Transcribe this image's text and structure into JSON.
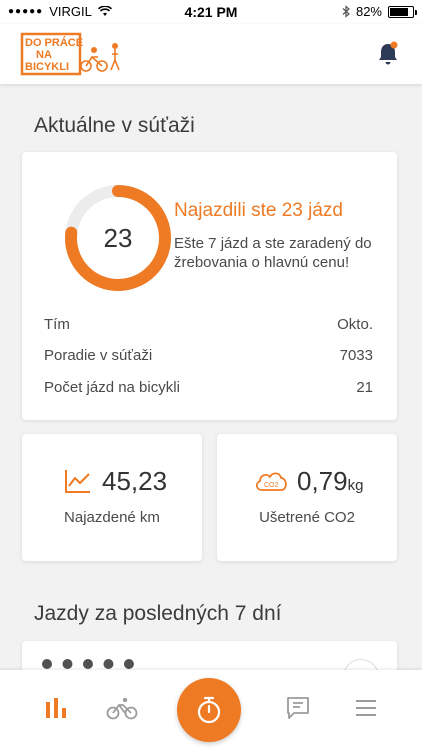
{
  "status_bar": {
    "carrier": "VIRGIL",
    "time": "4:21 PM",
    "battery": "82%",
    "battery_level": 0.82
  },
  "header": {
    "logo_text_line1": "DO PRÁCE",
    "logo_text_line2": "NA",
    "logo_text_line3": "BICYKLI",
    "has_notification": true
  },
  "competition": {
    "section_title": "Aktuálne v súťaži",
    "rides_count": "23",
    "progress": 0.767,
    "headline": "Najazdili ste 23 jázd",
    "subline": "Ešte 7 jázd a ste zaradený do žrebovania o hlavnú cenu!",
    "stats": [
      {
        "label": "Tím",
        "value": "Okto."
      },
      {
        "label": "Poradie v súťaži",
        "value": "7033"
      },
      {
        "label": "Počet jázd na bicykli",
        "value": "21"
      }
    ]
  },
  "metrics": {
    "distance": {
      "value": "45,23",
      "label": "Najazdené km"
    },
    "co2": {
      "value": "0,79",
      "unit": "kg",
      "label": "Ušetrené CO2",
      "icon_text": "CO2"
    }
  },
  "rides": {
    "section_title": "Jazdy za posledných 7 dní"
  },
  "colors": {
    "accent": "#ee7a24",
    "background": "#f2f2f2"
  },
  "nav": {
    "items": [
      "stats-icon",
      "bicycle-icon",
      "stopwatch-icon",
      "chat-icon",
      "menu-icon"
    ]
  }
}
